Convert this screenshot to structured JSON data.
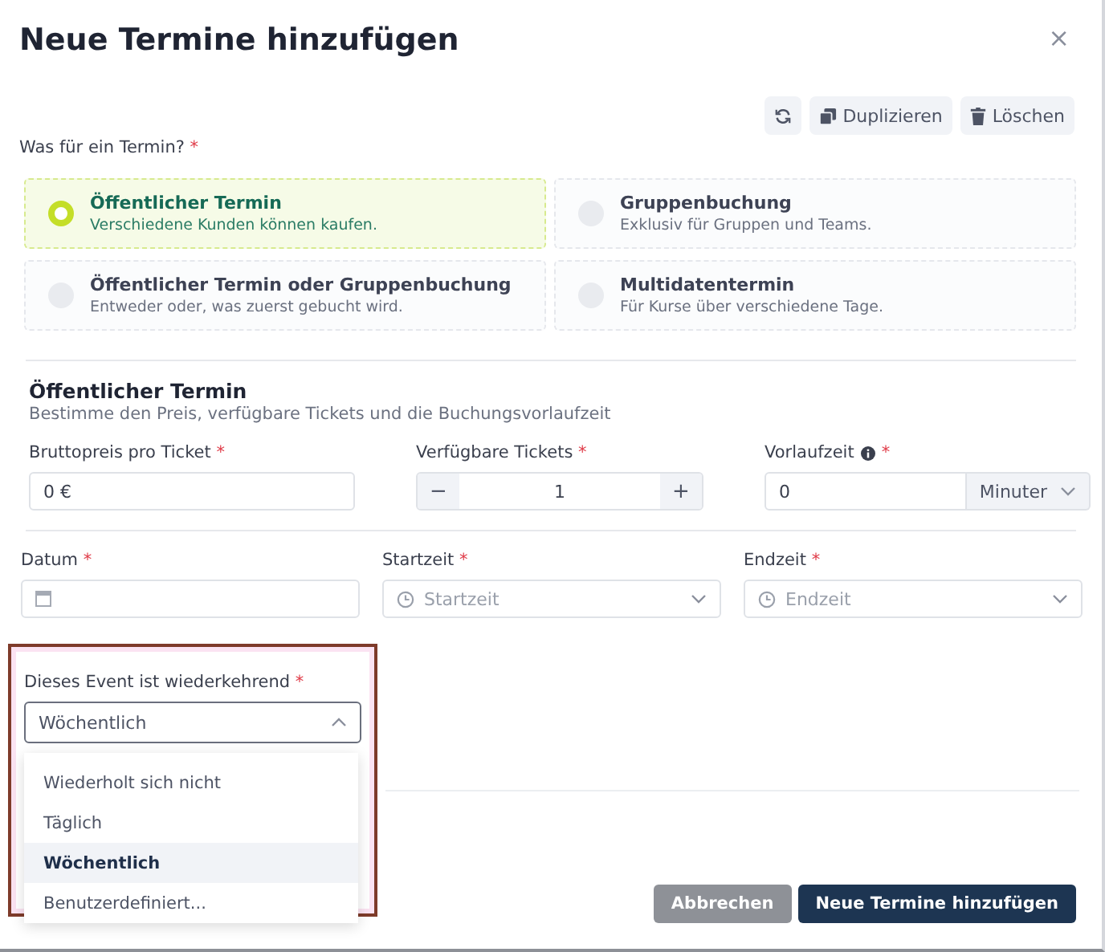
{
  "dialog": {
    "title": "Neue Termine hinzufügen",
    "close": "×"
  },
  "toolbar": [
    {
      "kind": "refresh"
    },
    {
      "kind": "copy",
      "label": "Duplizieren"
    },
    {
      "kind": "trash",
      "label": "Löschen"
    }
  ],
  "type_question": {
    "label": "Was für ein Termin?",
    "mark": "*"
  },
  "options": [
    {
      "title": "Öffentlicher Termin",
      "description": "Verschiedene Kunden können kaufen.",
      "selected": true
    },
    {
      "title": "Gruppenbuchung",
      "description": "Exklusiv für Gruppen und Teams.",
      "selected": false
    },
    {
      "title": "Öffentlicher Termin oder Gruppenbuchung",
      "description": "Entweder oder, was zuerst gebucht wird.",
      "selected": false
    },
    {
      "title": "Multidatentermin",
      "description": "Für Kurse über verschiedene Tage.",
      "selected": false
    }
  ],
  "section": {
    "title": "Öffentlicher Termin",
    "subtitle": "Bestimme den Preis, verfügbare Tickets und die Buchungsvorlaufzeit"
  },
  "price": {
    "label": "Bruttopreis pro Ticket",
    "mark": "*",
    "value": "0 €"
  },
  "tickets": {
    "label": "Verfügbare Tickets",
    "mark": "*",
    "minus": "−",
    "value": "1",
    "plus": "+"
  },
  "lead_time": {
    "label": "Vorlaufzeit",
    "mark": "*",
    "value": "0",
    "unit": "Minuter"
  },
  "date": {
    "label": "Datum",
    "mark": "*"
  },
  "start": {
    "label": "Startzeit",
    "mark": "*",
    "placeholder": "Startzeit"
  },
  "end": {
    "label": "Endzeit",
    "mark": "*",
    "placeholder": "Endzeit"
  },
  "recurring": {
    "label": "Dieses Event ist wiederkehrend",
    "mark": "*",
    "value": "Wöchentlich",
    "expanded": true,
    "options": [
      {
        "label": "Wiederholt sich nicht",
        "selected": false
      },
      {
        "label": "Täglich",
        "selected": false
      },
      {
        "label": "Wöchentlich",
        "selected": true
      },
      {
        "label": "Benutzerdefiniert...",
        "selected": false
      }
    ]
  },
  "buttons": [
    {
      "kind": "secondary",
      "label": "Abbrechen"
    },
    {
      "kind": "primary",
      "label": "Neue Termine hinzufügen"
    }
  ]
}
